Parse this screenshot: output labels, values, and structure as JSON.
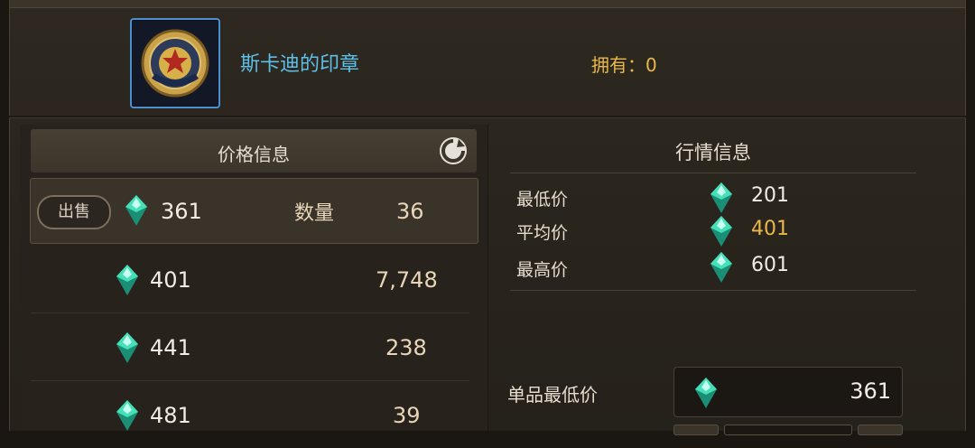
{
  "item": {
    "name": "斯卡迪的印章",
    "owned": "拥有：0"
  },
  "price_panel": {
    "title": "价格信息",
    "sell_label": "出售",
    "qty_label": "数量",
    "selected": {
      "price": "361",
      "qty": "36"
    },
    "rows": [
      {
        "price": "401",
        "qty": "7,748"
      },
      {
        "price": "441",
        "qty": "238"
      },
      {
        "price": "481",
        "qty": "39"
      }
    ]
  },
  "market_panel": {
    "title": "行情信息",
    "min_label": "最低价",
    "min_value": "201",
    "avg_label": "平均价",
    "avg_value": "401",
    "max_label": "最高价",
    "max_value": "601"
  },
  "unit_min": {
    "label": "单品最低价",
    "value": "361"
  },
  "colors": {
    "accent_blue": "#5cc0e8",
    "gold": "#e8b84a",
    "gem": "#2fc7a0"
  },
  "icons": [
    "seal-icon",
    "refresh-icon",
    "gem-icon"
  ]
}
